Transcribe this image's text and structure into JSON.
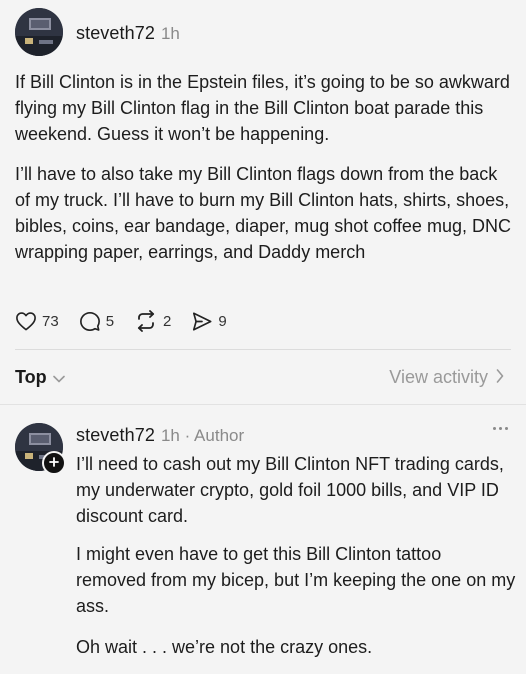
{
  "post": {
    "username": "steveth72",
    "time": "1h",
    "paragraphs": [
      "If Bill Clinton is in the Epstein files, it’s going to be so awkward flying my Bill Clinton flag in the Bill Clinton boat parade this weekend. Guess it won’t be happening.",
      "I’ll have to also take my Bill Clinton flags down from the back of my truck. I’ll have to burn my Bill Clinton hats, shirts, shoes, bibles, coins, ear bandage, diaper, mug shot coffee mug, DNC wrapping paper, earrings, and Daddy merch"
    ],
    "actions": {
      "likes": "73",
      "replies": "5",
      "reposts": "2",
      "shares": "9"
    }
  },
  "sort": {
    "label": "Top",
    "view_activity": "View activity"
  },
  "reply": {
    "username": "steveth72",
    "meta": "1h · Author",
    "paragraphs": [
      "I’ll need to cash out my Bill Clinton NFT trading cards, my underwater crypto, gold foil 1000 bills, and VIP ID discount card.",
      "I might even have to get this Bill Clinton tattoo removed from my bicep, but I’m keeping the one on my ass.",
      "Oh wait . . . we’re not the crazy ones."
    ]
  },
  "icons": {
    "like": "heart-icon",
    "reply": "comment-bubble-icon",
    "repost": "repost-arrows-icon",
    "share": "send-paper-plane-icon",
    "sort": "chevron-down-icon",
    "view_activity": "chevron-right-icon",
    "more": "more-dots-icon",
    "follow": "plus-icon"
  }
}
